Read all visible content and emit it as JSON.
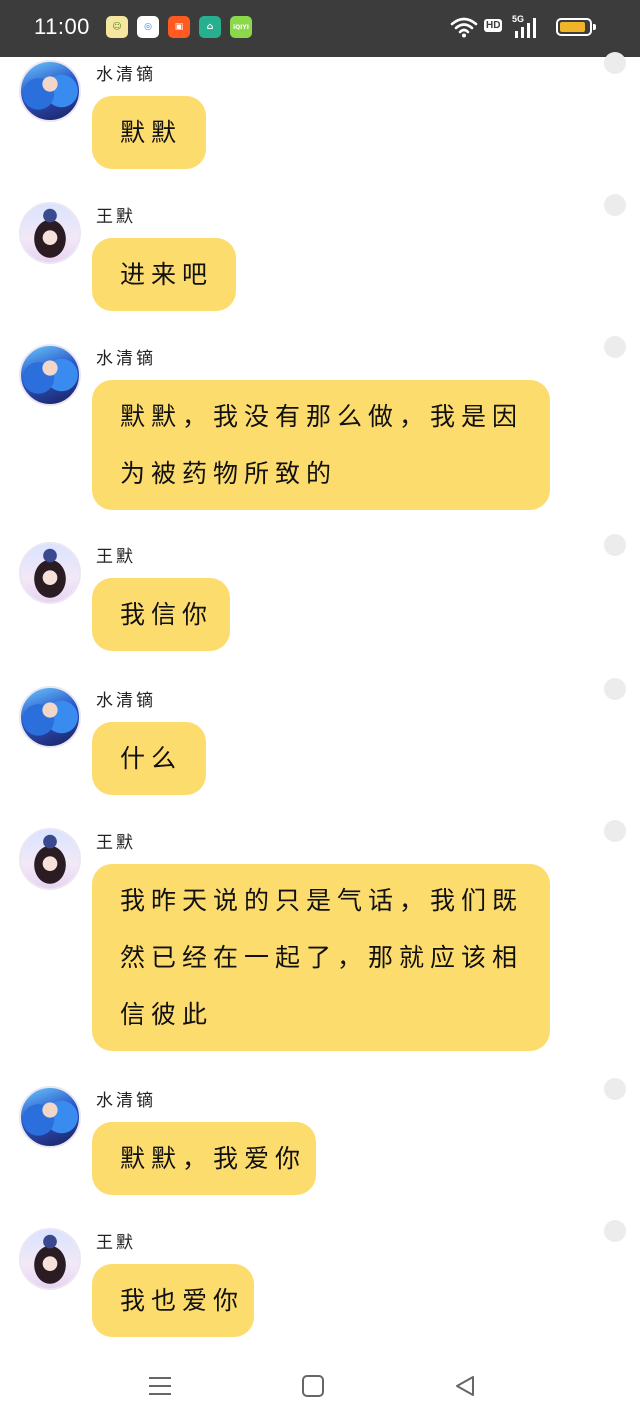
{
  "status_bar": {
    "time": "11:00",
    "apps": [
      {
        "icon": "app-icon-yellow",
        "glyph": "☺",
        "bg": "#f5e6a0",
        "fg": "#5a8a1f"
      },
      {
        "icon": "app-icon-blue",
        "glyph": "◎",
        "bg": "#ffffff",
        "fg": "#1e88e5"
      },
      {
        "icon": "app-icon-kuaishou",
        "glyph": "▣",
        "bg": "#ff5a1f",
        "fg": "#ffffff"
      },
      {
        "icon": "app-icon-home",
        "glyph": "⌂",
        "bg": "#27b08f",
        "fg": "#ffffff"
      },
      {
        "icon": "app-icon-iqiyi",
        "glyph": "iQIYI",
        "bg": "#8bd94a",
        "fg": "#ffffff"
      }
    ],
    "hd": "HD",
    "network": "5G",
    "battery_level": 0.9
  },
  "messages": [
    {
      "sender": "水清镝",
      "avatar": "blue",
      "lines": [
        "默默"
      ]
    },
    {
      "sender": "王默",
      "avatar": "dark",
      "lines": [
        "进来吧"
      ]
    },
    {
      "sender": "水清镝",
      "avatar": "blue",
      "lines": [
        "默默，我没有那么做，我是因",
        "为被药物所致的"
      ]
    },
    {
      "sender": "王默",
      "avatar": "dark",
      "lines": [
        "我信你"
      ]
    },
    {
      "sender": "水清镝",
      "avatar": "blue",
      "lines": [
        "什么"
      ]
    },
    {
      "sender": "王默",
      "avatar": "dark",
      "lines": [
        "我昨天说的只是气话，我们既",
        "然已经在一起了，那就应该相",
        "信彼此"
      ]
    },
    {
      "sender": "水清镝",
      "avatar": "blue",
      "lines": [
        "默默，我爱你"
      ]
    },
    {
      "sender": "王默",
      "avatar": "dark",
      "lines": [
        "我也爱你"
      ]
    }
  ],
  "colors": {
    "bubble": "#fddc6e",
    "status_bar": "#3c3c3c"
  },
  "nav": [
    "menu-icon",
    "home-square-icon",
    "back-triangle-icon"
  ]
}
